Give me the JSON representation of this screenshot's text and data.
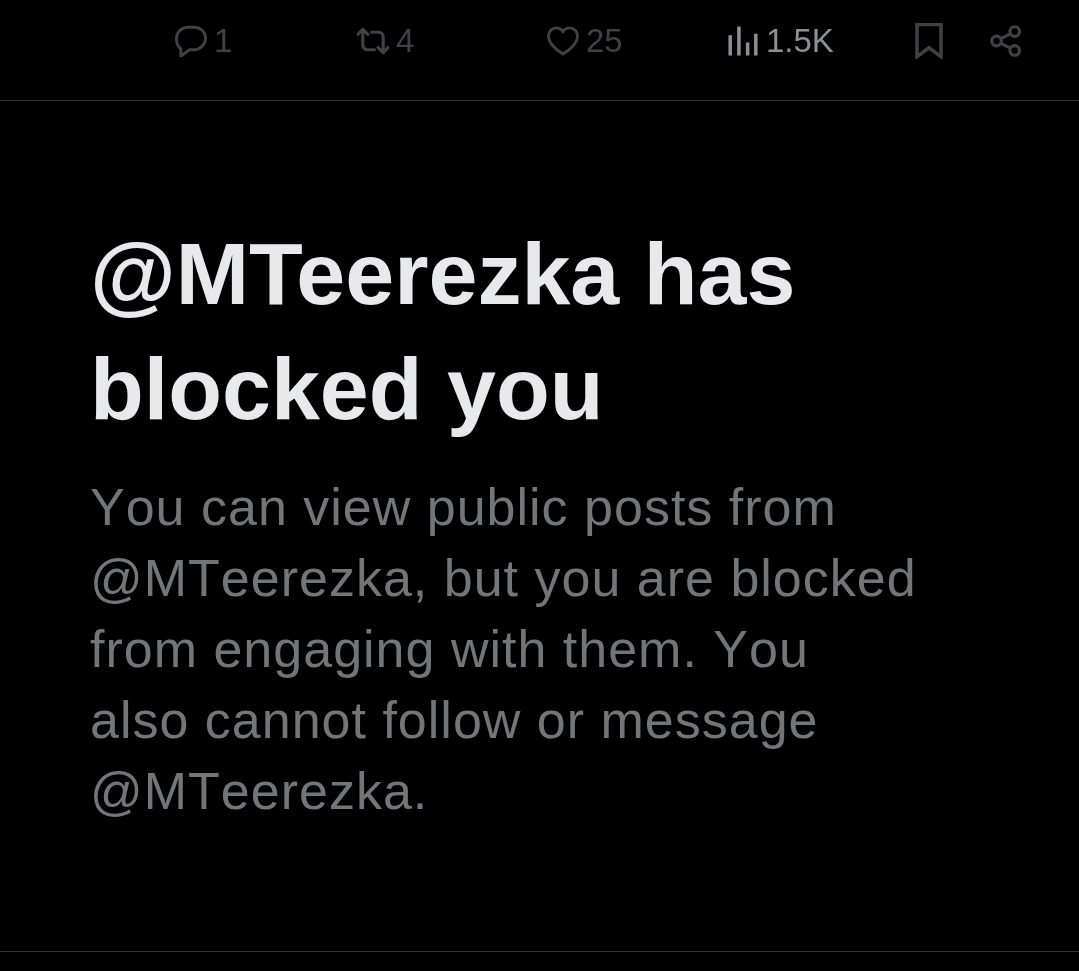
{
  "actions": [
    {
      "kind": "reply",
      "count": "1",
      "disabled": true
    },
    {
      "kind": "repost",
      "count": "4",
      "disabled": true
    },
    {
      "kind": "like",
      "count": "25",
      "disabled": true
    },
    {
      "kind": "views",
      "count": "1.5K",
      "disabled": false
    },
    {
      "kind": "bookmark",
      "disabled": true
    },
    {
      "kind": "share",
      "disabled": true
    }
  ],
  "notice": {
    "title": "@MTeerezka has blocked you",
    "message": "You can view public posts from @MTeerezka, but you are blocked from engaging with them. You also cannot follow or message @MTeerezka."
  }
}
